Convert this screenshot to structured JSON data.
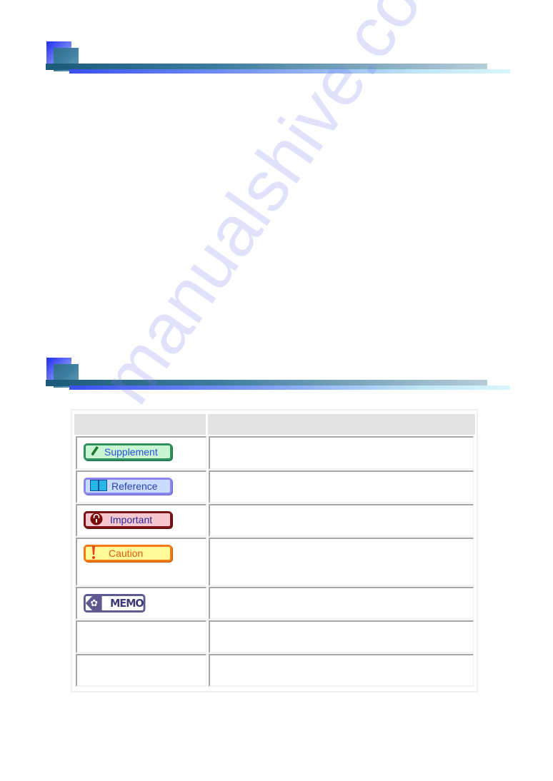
{
  "sections": [
    {
      "title": ""
    },
    {
      "title": ""
    }
  ],
  "table": {
    "headers": [
      "",
      ""
    ],
    "rows": [
      {
        "icon": "pencil-icon",
        "badge": "Supplement",
        "description": ""
      },
      {
        "icon": "book-icon",
        "badge": "Reference",
        "description": ""
      },
      {
        "icon": "lock-icon",
        "badge": "Important",
        "description": ""
      },
      {
        "icon": "exclamation-icon",
        "badge": "Caution",
        "description": ""
      },
      {
        "icon": "memo-flag-icon",
        "badge": "MEMO",
        "description": ""
      },
      {
        "icon": "",
        "badge": "",
        "description": ""
      },
      {
        "icon": "",
        "badge": "",
        "description": ""
      }
    ]
  },
  "watermark": "manualshive.com",
  "colors": {
    "supplement": "#2f9060",
    "reference": "#8a86ee",
    "important": "#7a1414",
    "caution": "#f07a14",
    "memo": "#5d5a90",
    "header_bg": "#e3e3e3"
  }
}
